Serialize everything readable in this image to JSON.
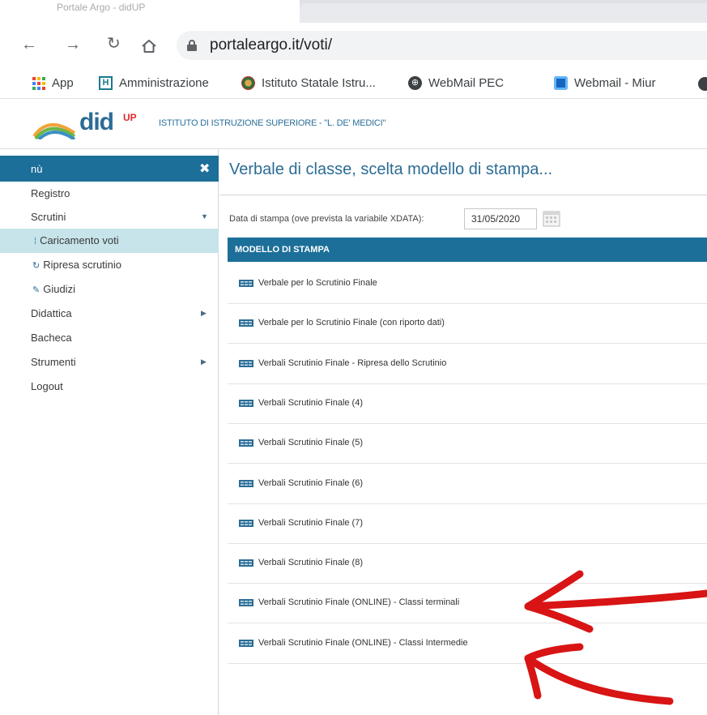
{
  "browser": {
    "tab_title": "Portale Argo - didUP",
    "url": "portaleargo.it/voti/",
    "bookmarks": [
      {
        "label": "App"
      },
      {
        "label": "Amministrazione"
      },
      {
        "label": "Istituto Statale Istru..."
      },
      {
        "label": "WebMail PEC"
      },
      {
        "label": "Webmail - Miur"
      }
    ]
  },
  "header": {
    "logo_text": "did",
    "logo_sup": "UP",
    "school_name": "ISTITUTO DI ISTRUZIONE SUPERIORE - \"L. DE' MEDICI\""
  },
  "sidebar": {
    "title": "nù",
    "close_glyph": "✖",
    "items": [
      {
        "label": "Registro"
      },
      {
        "label": "Scrutini"
      },
      {
        "label": "Caricamento voti"
      },
      {
        "label": "Ripresa scrutinio"
      },
      {
        "label": "Giudizi"
      },
      {
        "label": "Didattica"
      },
      {
        "label": "Bacheca"
      },
      {
        "label": "Strumenti"
      },
      {
        "label": "Logout"
      }
    ]
  },
  "main": {
    "title": "Verbale di classe, scelta modello di stampa...",
    "date_label": "Data di stampa (ove prevista la variabile XDATA):",
    "date_value": "31/05/2020",
    "table_header": "MODELLO DI STAMPA",
    "rows": [
      "Verbale per lo Scrutinio Finale",
      "Verbale per lo Scrutinio Finale (con riporto dati)",
      "Verbali Scrutinio Finale - Ripresa dello Scrutinio",
      "Verbali Scrutinio Finale (4)",
      "Verbali Scrutinio Finale (5)",
      "Verbali Scrutinio Finale (6)",
      "Verbali Scrutinio Finale (7)",
      "Verbali Scrutinio Finale (8)",
      "Verbali Scrutinio Finale (ONLINE) - Classi terminali",
      "Verbali Scrutinio Finale (ONLINE) - Classi Intermedie"
    ]
  },
  "colors": {
    "brand_blue": "#1c6f98",
    "active_item": "#c6e4ea",
    "annotation_red": "#d81414",
    "logo_red": "#e2272c"
  }
}
